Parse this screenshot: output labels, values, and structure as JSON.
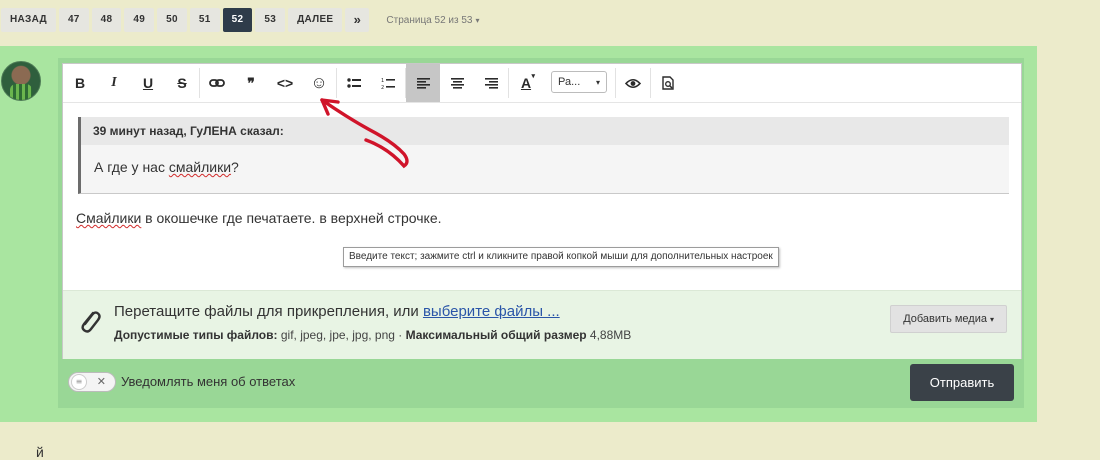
{
  "pagination": {
    "back_label": "НАЗАД",
    "pages": [
      "47",
      "48",
      "49",
      "50",
      "51",
      "52",
      "53"
    ],
    "active_page": "52",
    "next_label": "ДАЛЕЕ",
    "last_symbol": "»",
    "page_info": "Страница 52 из 53",
    "page_info_caret": "▾"
  },
  "toolbar": {
    "bold": "B",
    "italic": "I",
    "underline": "U",
    "strike": "S",
    "link_icon": "link-icon",
    "quote_glyph": "❞",
    "code_glyph": "<>",
    "smiley_glyph": "☺",
    "bullet_list_icon": "bullet-list-icon",
    "numbered_list_icon": "numbered-list-icon",
    "font_color_glyph": "A",
    "font_color_caret": "▾",
    "size_label": "Ра...",
    "size_caret": "▾"
  },
  "quote": {
    "header": "39 минут назад, ГуЛЕНА сказал:",
    "body_prefix": "А где у нас ",
    "body_misspelled": "смайлики",
    "body_suffix": "?"
  },
  "message": {
    "misspelled": "Смайлики",
    "rest": " в окошечке где печатаете. в верхней строчке."
  },
  "tooltip": "Введите текст; зажмите ctrl и кликните правой копкой мыши для дополнительных настроек",
  "attachments": {
    "main_text": "Перетащите файлы для прикрепления, или ",
    "link_text": "выберите файлы ...",
    "types_label": "Допустимые типы файлов:",
    "types_value": " gif, jpeg, jpe, jpg, png · ",
    "max_label": "Максимальный общий размер",
    "max_value": " 4,88MB",
    "media_button": "Добавить медиа",
    "media_caret": "▾"
  },
  "notify": {
    "label": "Уведомлять меня об ответах",
    "toggle_off": "✕"
  },
  "submit_label": "Отправить",
  "bottom_fragment": "й",
  "colors": {
    "page_bg": "#ecebcb",
    "post_bg": "#a9e5a0",
    "editor_frame": "#99d796",
    "active_page": "#2f3c4a",
    "submit_bg": "#3a4148",
    "annotation_arrow": "#d0142a",
    "link": "#2a55a8"
  }
}
